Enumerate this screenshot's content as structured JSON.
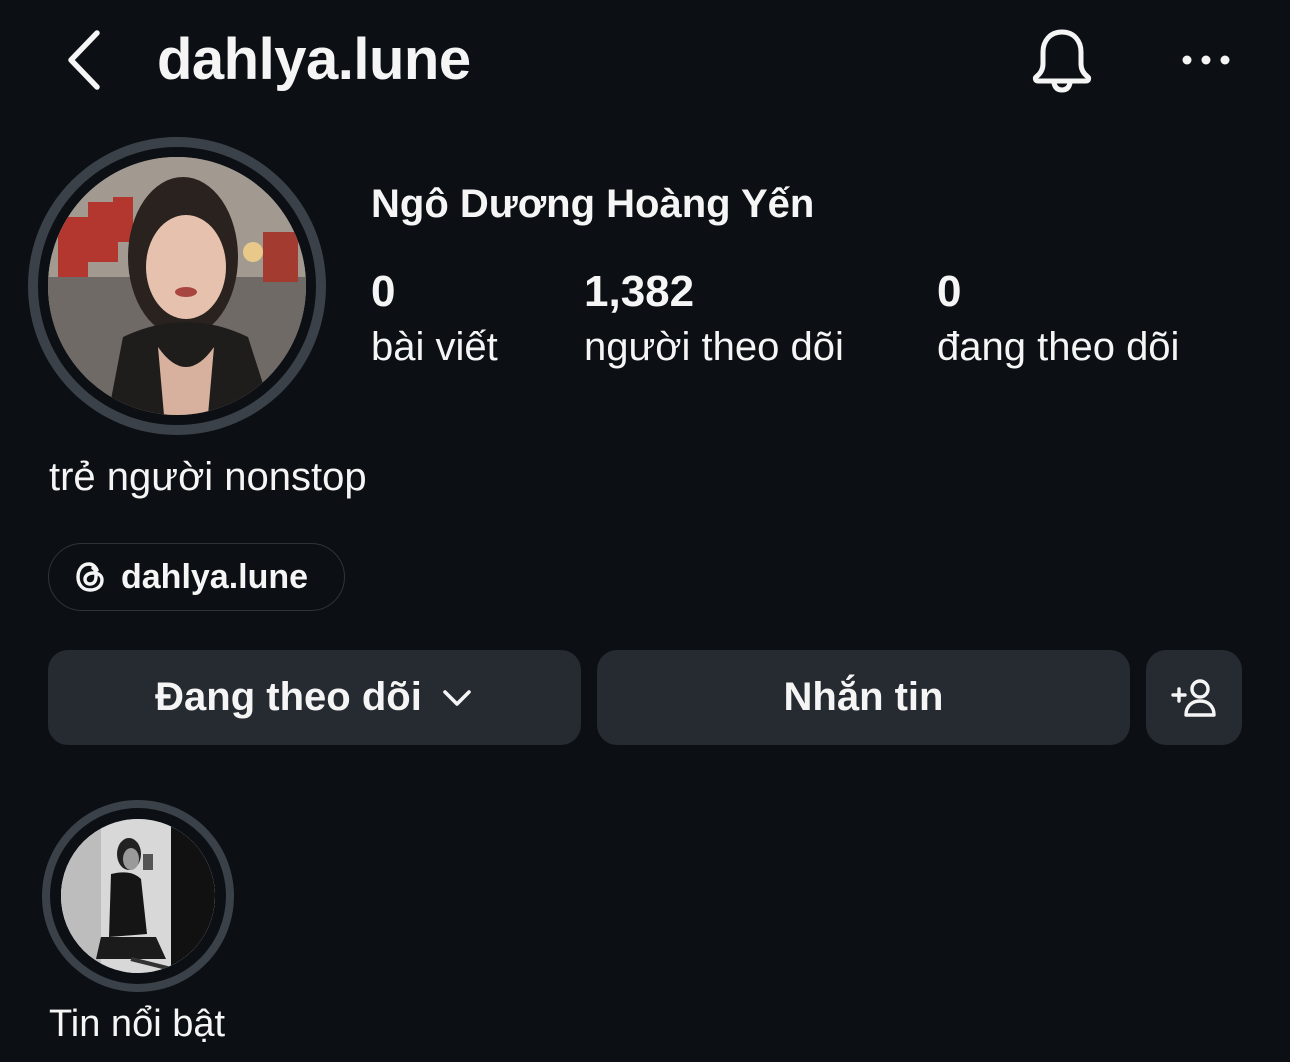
{
  "header": {
    "back_icon": "chevron-left-icon",
    "username": "dahlya.lune",
    "bell_icon": "bell-icon",
    "more_icon": "more-horizontal-icon"
  },
  "profile": {
    "full_name": "Ngô Dương Hoàng Yến",
    "stats": {
      "posts_count": "0",
      "posts_label": "bài viết",
      "followers_count": "1,382",
      "followers_label": "người theo dõi",
      "following_count": "0",
      "following_label": "đang theo dõi"
    },
    "bio": "trẻ người nonstop",
    "threads_link": {
      "icon": "threads-icon",
      "label": "dahlya.lune"
    }
  },
  "actions": {
    "following_label": "Đang theo dõi",
    "following_icon": "chevron-down-icon",
    "message_label": "Nhắn tin",
    "add_user_icon": "add-user-icon"
  },
  "highlights": [
    {
      "label": "Tin nổi bật"
    }
  ],
  "colors": {
    "background": "#0c1014",
    "button": "#262b31",
    "ring": "#3b4148",
    "text": "#f5f5f5"
  }
}
